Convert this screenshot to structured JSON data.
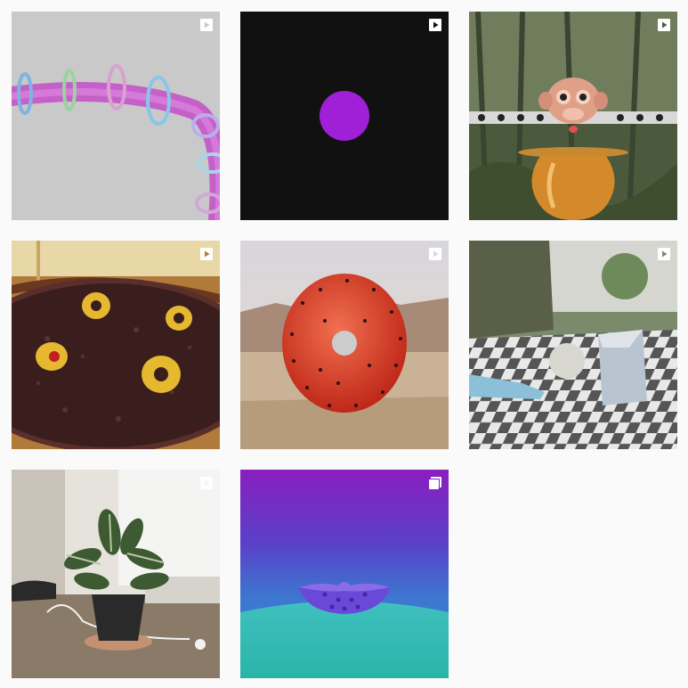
{
  "grid": {
    "posts": [
      {
        "type": "video",
        "badge_icon": "play-icon"
      },
      {
        "type": "video",
        "badge_icon": "play-icon"
      },
      {
        "type": "video",
        "badge_icon": "play-icon"
      },
      {
        "type": "video",
        "badge_icon": "play-icon"
      },
      {
        "type": "video",
        "badge_icon": "play-icon"
      },
      {
        "type": "video",
        "badge_icon": "play-icon"
      },
      {
        "type": "video",
        "badge_icon": "play-icon"
      },
      {
        "type": "carousel",
        "badge_icon": "carousel-icon"
      }
    ]
  },
  "colors": {
    "background": "#fafafa",
    "badge": "#ffffff"
  }
}
